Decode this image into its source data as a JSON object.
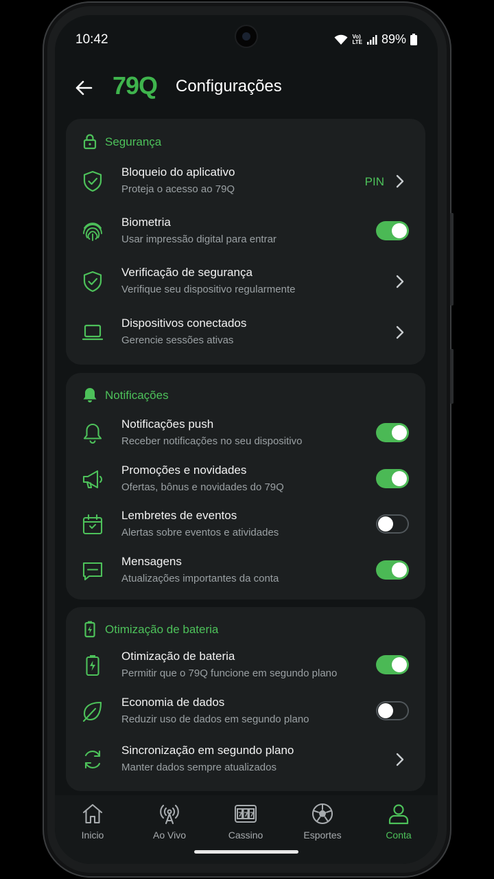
{
  "status": {
    "time": "10:42",
    "battery": "89%",
    "lte_top": "Vo)",
    "lte_bottom": "LTE"
  },
  "header": {
    "logo": "79Q",
    "title": "Configurações"
  },
  "colors": {
    "accent": "#4dc15a",
    "card": "#1c1f20",
    "background": "#111415"
  },
  "sections": [
    {
      "title": "Segurança",
      "icon": "lock-icon",
      "items": [
        {
          "title": "Bloqueio do aplicativo",
          "subtitle": "Proteja o acesso ao 79Q",
          "icon": "shield-check-icon",
          "value": "PIN",
          "control": "chevron"
        },
        {
          "title": "Biometria",
          "subtitle": "Usar impressão digital para entrar",
          "icon": "fingerprint-icon",
          "control": "toggle",
          "enabled": true
        },
        {
          "title": "Verificação de segurança",
          "subtitle": "Verifique seu dispositivo regularmente",
          "icon": "shield-check-icon",
          "control": "chevron"
        },
        {
          "title": "Dispositivos conectados",
          "subtitle": "Gerencie sessões ativas",
          "icon": "laptop-icon",
          "control": "chevron"
        }
      ]
    },
    {
      "title": "Notificações",
      "icon": "bell-filled-icon",
      "items": [
        {
          "title": "Notificações push",
          "subtitle": "Receber notificações no seu dispositivo",
          "icon": "bell-icon",
          "control": "toggle",
          "enabled": true
        },
        {
          "title": "Promoções e novidades",
          "subtitle": "Ofertas, bônus e novidades do 79Q",
          "icon": "megaphone-icon",
          "control": "toggle",
          "enabled": true
        },
        {
          "title": "Lembretes de eventos",
          "subtitle": "Alertas sobre eventos e atividades",
          "icon": "calendar-icon",
          "control": "toggle",
          "enabled": false
        },
        {
          "title": "Mensagens",
          "subtitle": "Atualizações importantes da conta",
          "icon": "message-icon",
          "control": "toggle",
          "enabled": true
        }
      ]
    },
    {
      "title": "Otimização de bateria",
      "icon": "battery-charging-filled-icon",
      "items": [
        {
          "title": "Otimização de bateria",
          "subtitle": "Permitir que o 79Q funcione em segundo plano",
          "icon": "battery-charging-icon",
          "control": "toggle",
          "enabled": true
        },
        {
          "title": "Economia de dados",
          "subtitle": "Reduzir uso de dados em segundo plano",
          "icon": "leaf-icon",
          "control": "toggle",
          "enabled": false
        },
        {
          "title": "Sincronização em segundo plano",
          "subtitle": "Manter dados sempre atualizados",
          "icon": "sync-icon",
          "control": "chevron"
        }
      ]
    }
  ],
  "nav": [
    {
      "label": "Inicio",
      "icon": "home-icon",
      "active": false
    },
    {
      "label": "Ao Vivo",
      "icon": "broadcast-icon",
      "active": false
    },
    {
      "label": "Cassino",
      "icon": "slot-machine-icon",
      "active": false
    },
    {
      "label": "Esportes",
      "icon": "soccer-ball-icon",
      "active": false
    },
    {
      "label": "Conta",
      "icon": "user-icon",
      "active": true
    }
  ]
}
